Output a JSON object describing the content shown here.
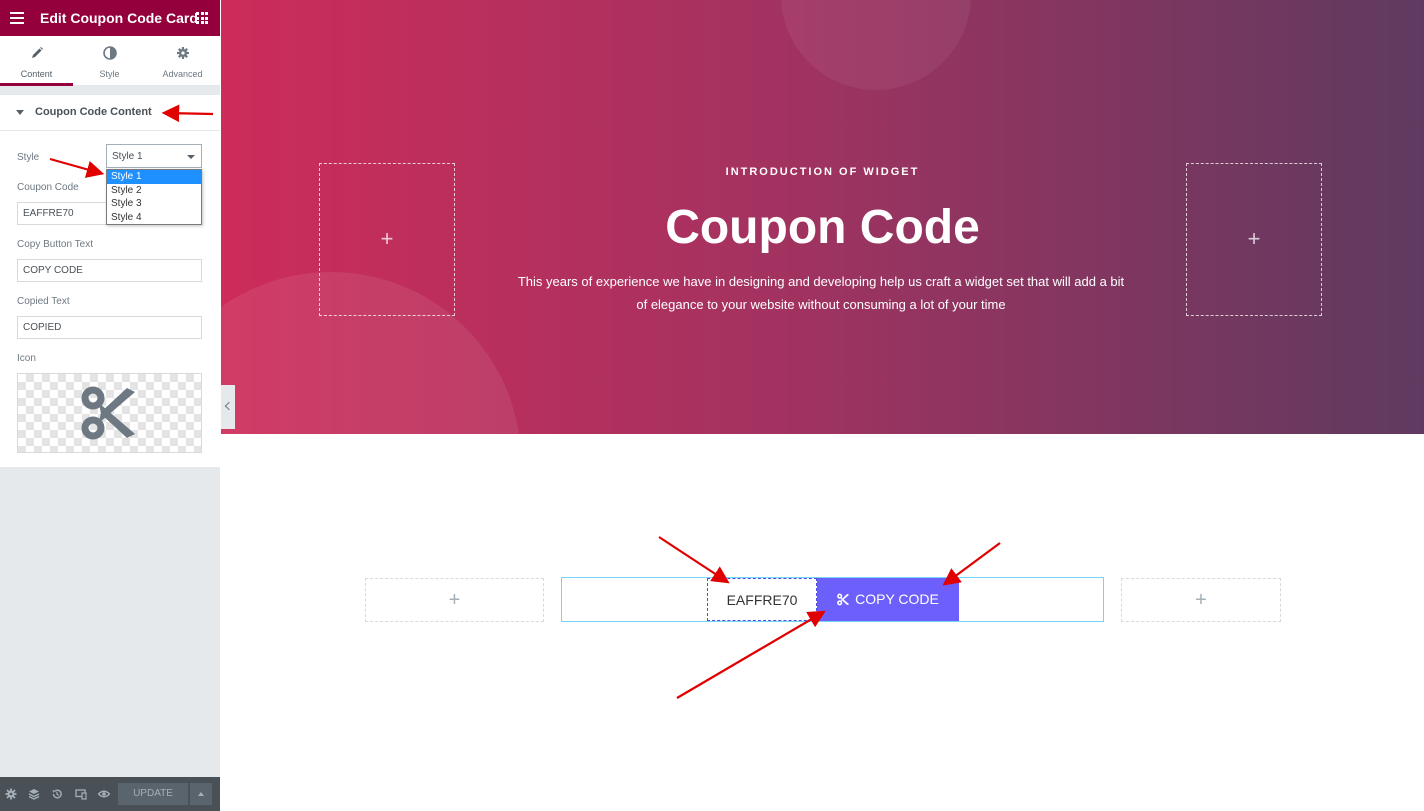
{
  "editor": {
    "title": "Edit Coupon Code Card",
    "tabs": [
      {
        "label": "Content"
      },
      {
        "label": "Style"
      },
      {
        "label": "Advanced"
      }
    ],
    "section_title": "Coupon Code Content",
    "controls": {
      "style_label": "Style",
      "style_value": "Style 1",
      "style_options": [
        "Style 1",
        "Style 2",
        "Style 3",
        "Style 4"
      ],
      "coupon_code_label": "Coupon Code",
      "coupon_code_value": "EAFFRE70",
      "copy_button_text_label": "Copy Button Text",
      "copy_button_text_value": "COPY CODE",
      "copied_text_label": "Copied Text",
      "copied_text_value": "COPIED",
      "icon_label": "Icon",
      "icon_name": "scissors-icon"
    },
    "footer": {
      "update_label": "UPDATE"
    },
    "colors": {
      "header_bg": "#93003c",
      "panel_bg": "#e6e9ec",
      "footer_bg": "#495157"
    }
  },
  "hero": {
    "eyebrow": "INTRODUCTION OF WIDGET",
    "title": "Coupon Code",
    "description": "This years of experience we have in designing and developing help us craft a widget set that will add a bit of elegance to your website without consuming a lot of your time",
    "plus_left": "+",
    "plus_right": "+",
    "gradient": [
      "#cd2c5a",
      "#5f3a60"
    ]
  },
  "coupon_row": {
    "plus_left": "+",
    "plus_right": "+",
    "code": "EAFFRE70",
    "button_label": "COPY CODE",
    "button_color": "#6c5ffc"
  }
}
